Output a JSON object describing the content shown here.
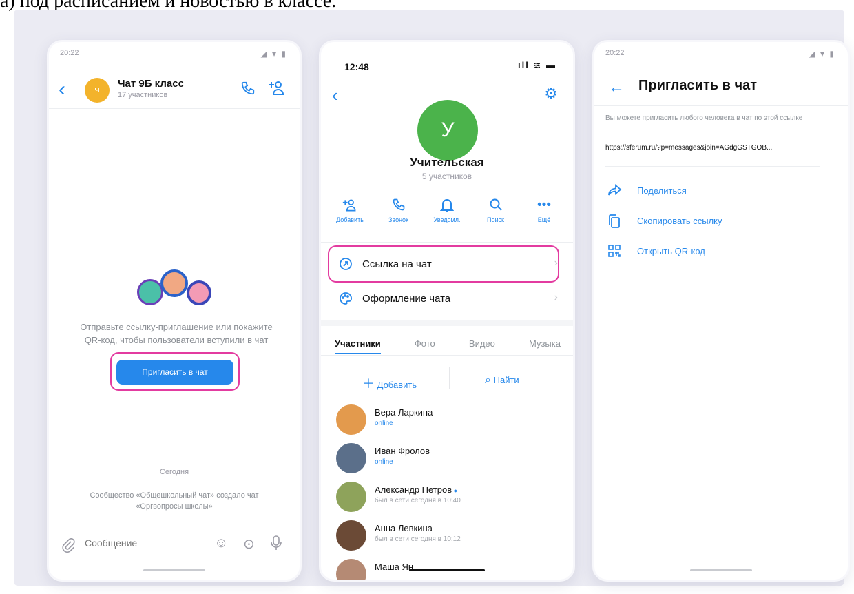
{
  "caption": "а) под расписанием и новостью в классе.",
  "phone_left": {
    "status_time": "20:22",
    "status_icons": "◢ ▾ ▮",
    "back_icon": "chevron-left-icon",
    "avatar_text": "Ч",
    "chat_title": "Чат 9Б класс",
    "chat_members": "17 участников",
    "call_icon": "phone-icon",
    "add_user_icon": "add-user-icon",
    "empty_text": "Отправьте ссылку-приглашение или покажите QR-код, чтобы пользователи вступили в чат",
    "invite_button": "Пригласить в чат",
    "date_label": "Сегодня",
    "service_message": "Сообщество «Общешкольный чат» создало чат «Оргвопросы школы»",
    "message_placeholder": "Сообщение"
  },
  "phone_middle": {
    "status_time": "12:48",
    "status_icons": "ıll ≋ ▬",
    "avatar_letter": "У",
    "group_name": "Учительская",
    "group_members": "5 участников",
    "actions": [
      {
        "icon": "add-user-icon",
        "label": "Добавить"
      },
      {
        "icon": "phone-icon",
        "label": "Звонок"
      },
      {
        "icon": "bell-icon",
        "label": "Уведомл."
      },
      {
        "icon": "search-icon",
        "label": "Поиск"
      },
      {
        "icon": "more-icon",
        "label": "Ещё"
      }
    ],
    "menu": [
      {
        "icon": "link-icon",
        "label": "Ссылка на чат"
      },
      {
        "icon": "palette-icon",
        "label": "Оформление чата"
      }
    ],
    "tabs": [
      "Участники",
      "Фото",
      "Видео",
      "Музыка"
    ],
    "add_label": "Добавить",
    "find_label": "Найти",
    "members": [
      {
        "name": "Вера Ларкина",
        "status": "online",
        "online": true,
        "color": "#e39a4d"
      },
      {
        "name": "Иван Фролов",
        "status": "online",
        "online": true,
        "color": "#5b6f8a"
      },
      {
        "name": "Александр Петров",
        "status": "был в сети сегодня в 10:40",
        "online": false,
        "color": "#8ea35b"
      },
      {
        "name": "Анна Левкина",
        "status": "был в сети сегодня в 10:12",
        "online": false,
        "color": "#6b4a36"
      },
      {
        "name": "Маша Ян",
        "status": "",
        "online": false,
        "color": "#b58a74"
      }
    ]
  },
  "phone_right": {
    "status_time": "20:22",
    "status_icons": "◢ ▾ ▮",
    "title": "Пригласить в чат",
    "description": "Вы можете пригласить любого человека в чат по этой ссылке",
    "link": "https://sferum.ru/?p=messages&join=AGdgGSTGOB...",
    "options": [
      {
        "icon": "share-icon",
        "label": "Поделиться"
      },
      {
        "icon": "copy-icon",
        "label": "Скопировать ссылку"
      },
      {
        "icon": "qr-icon",
        "label": "Открыть QR-код"
      }
    ]
  },
  "colors": {
    "accent": "#2688eb",
    "highlight": "#e33ba0",
    "green": "#4bb34b",
    "yellow": "#f3b32b"
  }
}
